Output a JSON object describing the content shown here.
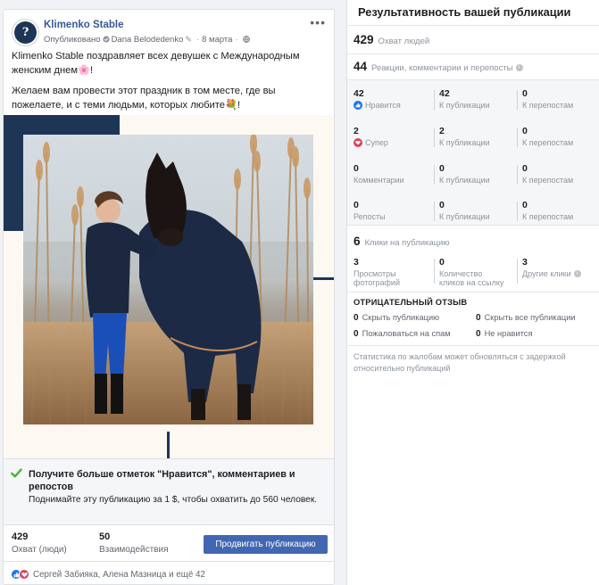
{
  "post": {
    "page_name": "Klimenko Stable",
    "published_label": "Опубликовано",
    "author": "Dana Belodedenko",
    "date": "8 марта",
    "avatar_letter": "?",
    "text_p1": "Klimenko Stable поздравляет всех девушек с Международным женским днем🌸!",
    "text_p2": "Желаем вам провести этот праздник в том месте, где вы пожелаете, и с теми людьми, которых любите💐!"
  },
  "promo": {
    "title": "Получите больше отметок \"Нравится\", комментариев и репостов",
    "subtitle": "Поднимайте эту публикацию за 1 $, чтобы охватить до 560 человек."
  },
  "stats": {
    "reach_value": "429",
    "reach_label": "Охват (люди)",
    "engagement_value": "50",
    "engagement_label": "Взаимодействия",
    "boost_button": "Продвигать публикацию"
  },
  "reactions_line": "Сергей Забияка, Алена Мазница и ещё 42",
  "insights": {
    "title": "Результативность вашей публикации",
    "reach_value": "429",
    "reach_label": "Охват людей",
    "reactions_value": "44",
    "reactions_label": "Реакции, комментарии и перепосты",
    "rows": [
      {
        "c1_value": "42",
        "c1_label": "Нравится",
        "c2_value": "42",
        "c2_label": "К публикации",
        "c3_value": "0",
        "c3_label": "К перепостам"
      },
      {
        "c1_value": "2",
        "c1_label": "Супер",
        "c2_value": "2",
        "c2_label": "К публикации",
        "c3_value": "0",
        "c3_label": "К перепостам"
      },
      {
        "c1_value": "0",
        "c1_label": "Комментарии",
        "c2_value": "0",
        "c2_label": "К публикации",
        "c3_value": "0",
        "c3_label": "К перепостам"
      },
      {
        "c1_value": "0",
        "c1_label": "Репосты",
        "c2_value": "0",
        "c2_label": "К публикации",
        "c3_value": "0",
        "c3_label": "К перепостам"
      }
    ],
    "clicks_value": "6",
    "clicks_label": "Клики на публикацию",
    "clicks": [
      {
        "value": "3",
        "label_1": "Просмотры",
        "label_2": "фотографий"
      },
      {
        "value": "0",
        "label_1": "Количество",
        "label_2": "кликов на ссылку"
      },
      {
        "value": "3",
        "label_1": "Другие клики",
        "label_2": ""
      }
    ],
    "negative_title": "ОТРИЦАТЕЛЬНЫЙ ОТЗЫВ",
    "negative": [
      {
        "value": "0",
        "label": "Скрыть публикацию"
      },
      {
        "value": "0",
        "label": "Скрыть все публикации"
      },
      {
        "value": "0",
        "label": "Пожаловаться на спам"
      },
      {
        "value": "0",
        "label": "Не нравится"
      }
    ],
    "note": "Статистика по жалобам может обновляться с задержкой относительно публикаций"
  },
  "colors": {
    "brand_blue": "#4267b2",
    "link_blue": "#385898",
    "frame_navy": "#1f3556",
    "like_blue": "#1877f2",
    "love_red": "#e0405a"
  }
}
